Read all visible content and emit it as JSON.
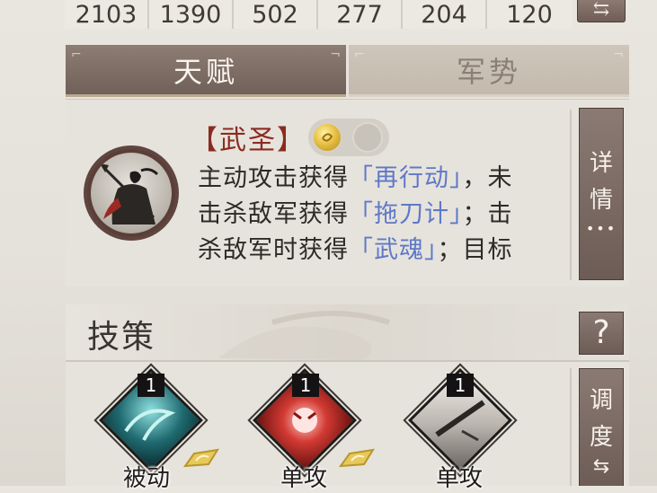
{
  "stats": [
    "2103",
    "1390",
    "502",
    "277",
    "204",
    "120"
  ],
  "tabs": [
    {
      "label": "天赋",
      "active": true
    },
    {
      "label": "军势",
      "active": false
    }
  ],
  "talent": {
    "name": "【武圣】",
    "lines": [
      {
        "pre": "主动攻击获得",
        "hl": "「再行动」",
        "post": "，未"
      },
      {
        "pre": "击杀敌军获得",
        "hl": "「拖刀计」",
        "post": "；击"
      },
      {
        "pre": "杀敌军时获得",
        "hl": "「武魂」",
        "post": "；目标"
      }
    ],
    "detail_button": {
      "c1": "详",
      "c2": "情",
      "dots": "•••"
    }
  },
  "skills": {
    "title": "技策",
    "help_label": "?",
    "adjust_button": {
      "c1": "调",
      "c2": "度"
    },
    "items": [
      {
        "level": "1",
        "label": "被动",
        "icon": "wave-skill-icon"
      },
      {
        "level": "1",
        "label": "单攻",
        "icon": "demon-mask-skill-icon"
      },
      {
        "level": "1",
        "label": "单攻",
        "icon": "blade-slash-skill-icon"
      }
    ]
  },
  "colors": {
    "accent_brown": "#7a6860",
    "highlight_blue": "#5f78c8",
    "name_red": "#8a2b22"
  }
}
